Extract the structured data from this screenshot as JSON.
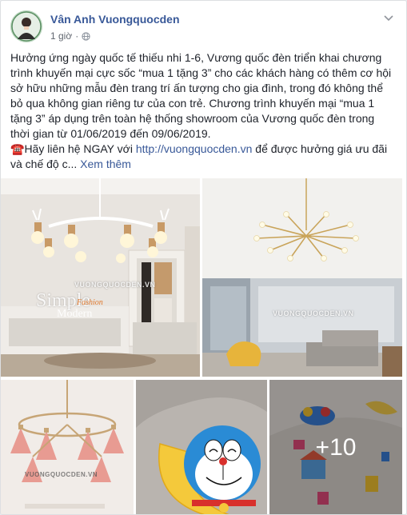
{
  "post": {
    "author": "Vân Anh Vuongquocden",
    "time": "1 giờ",
    "body_text": "Hưởng ứng ngày quốc tế thiếu nhi 1-6, Vương quốc đèn triển khai chương trình khuyến mại cực sốc “mua 1 tặng 3” cho các khách hàng có thêm cơ hội sở hữu những mẫu đèn trang trí ấn tượng cho gia đình, trong đó không thể bỏ qua không gian riêng tư của con trẻ. Chương trình khuyến mại “mua 1 tặng 3” áp dụng trên toàn hệ thống showroom của Vương quốc đèn trong thời gian từ 01/06/2019 đến 09/06/2019.",
    "phone_emoji": "☎️",
    "contact_prefix": "Hãy liên hệ NGAY với ",
    "link": "http://vuongquocden.vn",
    "contact_suffix": " để được hưởng giá ưu đãi và chế độ c...",
    "see_more": "Xem thêm"
  },
  "photos": {
    "watermark": "VUONGQUOCDEN.VN",
    "photo1_brand_main": "Simple",
    "photo1_brand_script": "Fashion",
    "photo1_brand_sub": "Modern",
    "more_count": "+10"
  },
  "icons": {
    "globe": "globe-icon",
    "chevron": "chevron-down-icon"
  },
  "colors": {
    "link": "#385898",
    "text": "#1d2129",
    "meta": "#616770"
  }
}
